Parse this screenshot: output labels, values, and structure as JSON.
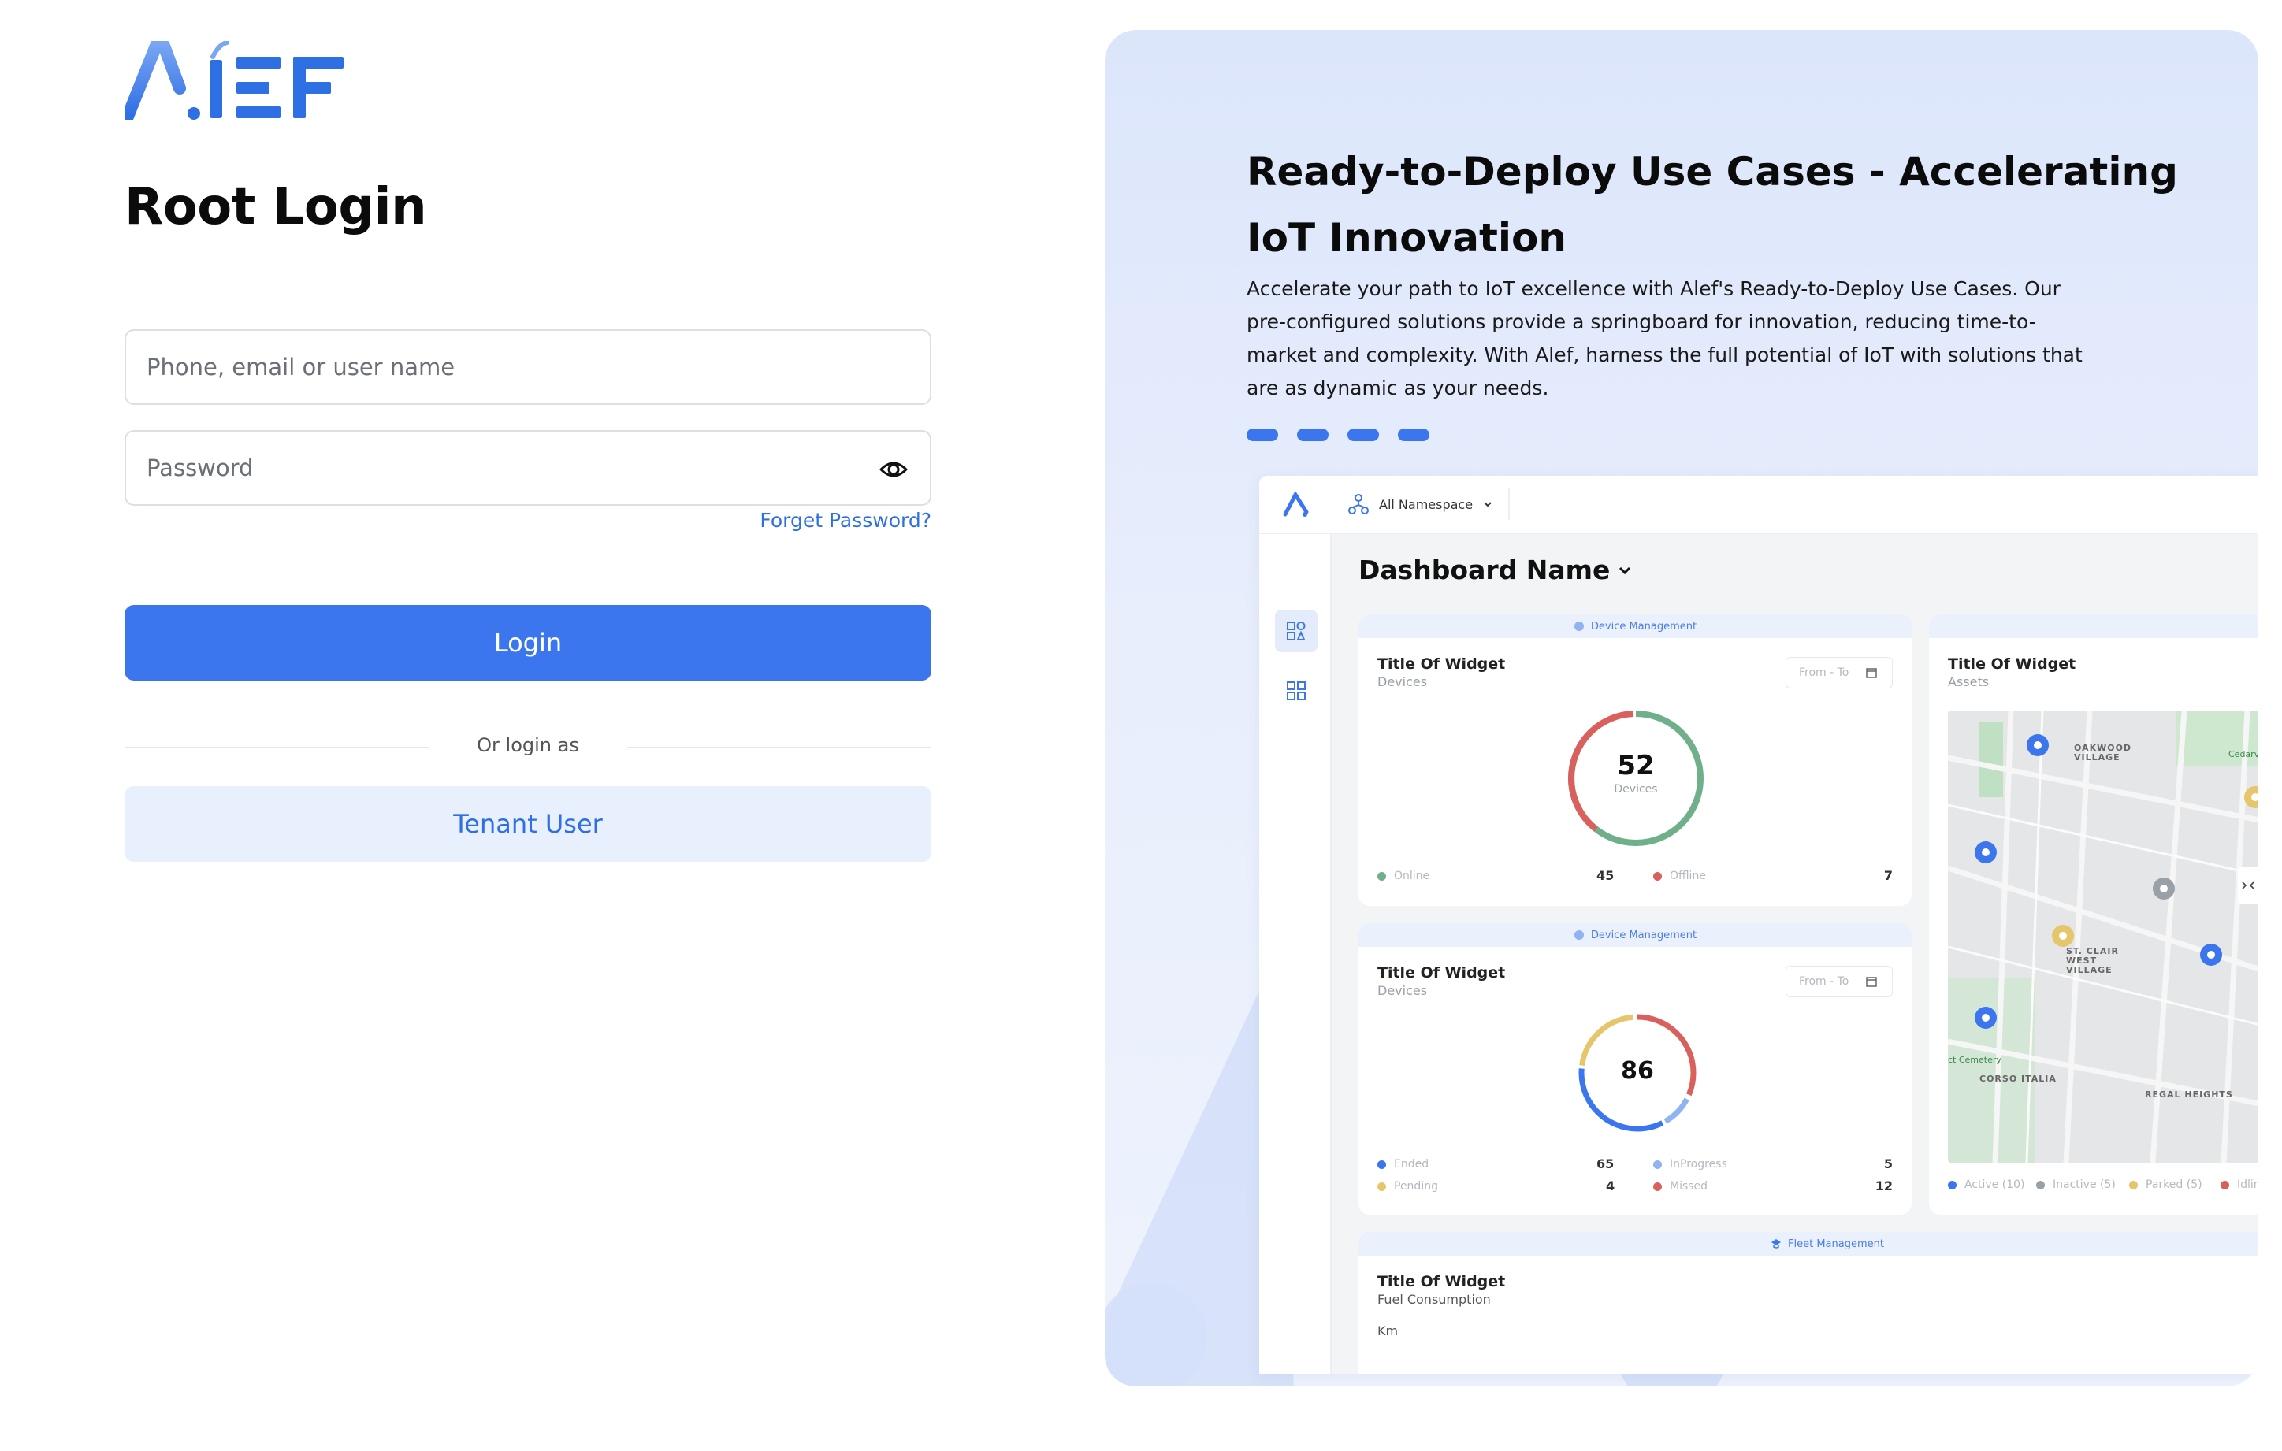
{
  "brand": {
    "logo_text": "AlEF"
  },
  "login": {
    "title": "Root Login",
    "username_placeholder": "Phone, email or user name",
    "password_placeholder": "Password",
    "forgot_label": "Forget Password?",
    "login_label": "Login",
    "or_label": "Or login as",
    "tenant_label": "Tenant User"
  },
  "hero": {
    "title": "Ready-to-Deploy Use Cases - Accelerating IoT Innovation",
    "description": "Accelerate your path to IoT excellence with Alef's Ready-to-Deploy Use Cases. Our pre-configured solutions provide a springboard for innovation, reducing time-to-market and complexity. With Alef, harness the full potential of IoT with solutions that are as dynamic as your needs.",
    "carousel_count": 4
  },
  "dashboard": {
    "namespace": "All Namespace",
    "name": "Dashboard Name",
    "widget1": {
      "band": "Device Management",
      "title": "Title Of Widget",
      "subtitle": "Devices",
      "date": "From - To",
      "total": "52",
      "total_label": "Devices",
      "legend": [
        {
          "label": "Online",
          "value": "45",
          "color": "#6fb08a"
        },
        {
          "label": "Offline",
          "value": "7",
          "color": "#d9605c"
        }
      ]
    },
    "widget2": {
      "band": "Device Management",
      "title": "Title Of Widget",
      "subtitle": "Devices",
      "date": "From - To",
      "total": "86",
      "legend": [
        {
          "label": "Ended",
          "value": "65",
          "color": "#3b76ee"
        },
        {
          "label": "InProgress",
          "value": "5",
          "color": "#8fb3f3"
        },
        {
          "label": "Pending",
          "value": "4",
          "color": "#e5c66a"
        },
        {
          "label": "Missed",
          "value": "12",
          "color": "#d9605c"
        }
      ]
    },
    "widget3": {
      "title": "Title Of Widget",
      "subtitle": "Assets",
      "map_labels": [
        "OAKWOOD VILLAGE",
        "ST. CLAIR WEST VILLAGE",
        "CORSO ITALIA",
        "REGAL HEIGHTS",
        "ct Cemetery",
        "Cedarv"
      ],
      "legend": [
        {
          "label": "Active (10)",
          "color": "#3b76ee"
        },
        {
          "label": "Inactive (5)",
          "color": "#9aa0a8"
        },
        {
          "label": "Parked (5)",
          "color": "#e5c66a"
        },
        {
          "label": "Idlin",
          "color": "#d9605c"
        }
      ]
    },
    "widget4": {
      "band": "Fleet Management",
      "title": "Title Of Widget",
      "subtitle": "Fuel Consumption",
      "unit": "Km"
    }
  }
}
